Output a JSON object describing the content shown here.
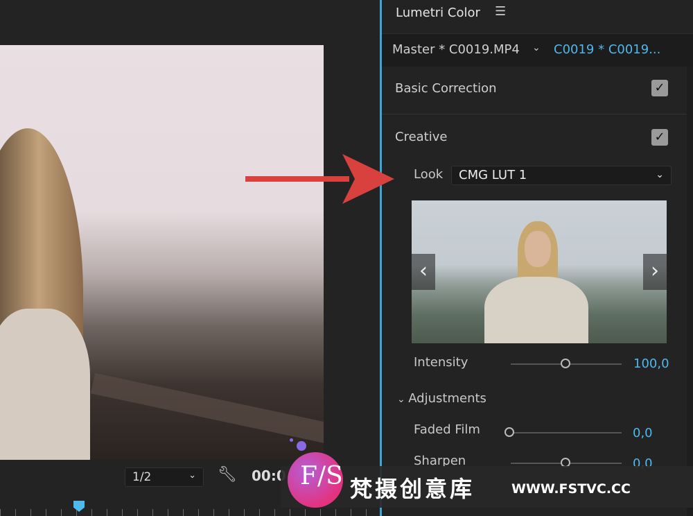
{
  "monitor": {
    "zoom_select": "1/2",
    "timecode": "00:0"
  },
  "panel": {
    "title": "Lumetri Color",
    "tabs": {
      "master": "Master * C0019.MP4",
      "clip": "C0019 * C0019..."
    },
    "basic_correction": {
      "label": "Basic Correction",
      "checked": true
    },
    "creative": {
      "label": "Creative",
      "checked": true,
      "look_label": "Look",
      "look_value": "CMG LUT 1",
      "intensity_label": "Intensity",
      "intensity_value": "100,0",
      "adjustments_label": "Adjustments",
      "faded_film_label": "Faded Film",
      "faded_film_value": "0,0",
      "sharpen_label": "Sharpen",
      "sharpen_value": "0,0"
    }
  },
  "check_glyph": "✓",
  "watermark": {
    "logo": "FS",
    "text_cn": "梵摄创意库",
    "url": "WWW.FSTVC.CC"
  },
  "colors": {
    "accent": "#4fb8ec",
    "arrow": "#d9413f"
  }
}
